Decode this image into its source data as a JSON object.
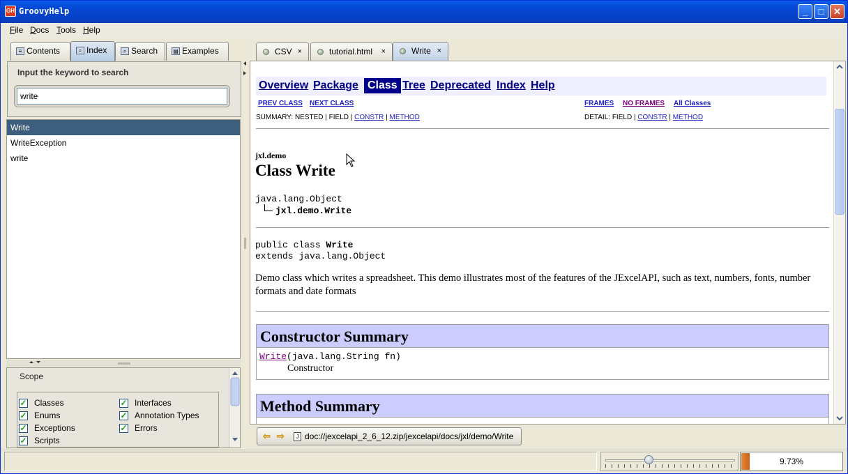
{
  "window": {
    "title": "GroovyHelp",
    "icon_label": "GH",
    "minimize": "_",
    "maximize": "□",
    "close": "✕"
  },
  "menubar": [
    {
      "key": "F",
      "rest": "ile"
    },
    {
      "key": "D",
      "rest": "ocs"
    },
    {
      "key": "T",
      "rest": "ools"
    },
    {
      "key": "H",
      "rest": "elp"
    }
  ],
  "left_tabs": [
    "Contents",
    "Index",
    "Search",
    "Examples"
  ],
  "left_tabs_selected": "Index",
  "index_panel": {
    "label": "Input the keyword to search",
    "search_value": "write"
  },
  "results": [
    "Write",
    "WriteException",
    "write"
  ],
  "selected_result": "Write",
  "scope": {
    "label": "Scope",
    "options": [
      {
        "label": "Classes",
        "checked": true
      },
      {
        "label": "Interfaces",
        "checked": true
      },
      {
        "label": "Enums",
        "checked": true
      },
      {
        "label": "Annotation Types",
        "checked": true
      },
      {
        "label": "Exceptions",
        "checked": true
      },
      {
        "label": "Errors",
        "checked": true
      },
      {
        "label": "Scripts",
        "checked": true
      }
    ]
  },
  "doc_tabs": [
    "CSV",
    "tutorial.html",
    "Write"
  ],
  "doc_tabs_selected": "Write",
  "tab_close_glyph": "×",
  "javadoc": {
    "nav": [
      "Overview",
      "Package",
      "Class",
      "Tree",
      "Deprecated",
      "Index",
      "Help"
    ],
    "nav_selected": "Class",
    "prev_class": "PREV CLASS",
    "next_class": "NEXT CLASS",
    "frames": "FRAMES",
    "no_frames": "NO FRAMES",
    "all_classes": "All Classes",
    "summary_prefix": "SUMMARY: NESTED | FIELD | ",
    "detail_prefix": "DETAIL: FIELD | ",
    "constr": "CONSTR",
    "method": "METHOD",
    "separator": " | ",
    "package": "jxl.demo",
    "class_title": "Class Write",
    "inherit_root": "java.lang.Object",
    "inherit_child": "jxl.demo.Write",
    "decl_line1_prefix": "public class ",
    "decl_line1_name": "Write",
    "decl_line2": "extends java.lang.Object",
    "description": "Demo class which writes a spreadsheet. This demo illustrates most of the features of the JExcelAPI, such as text, numbers, fonts, number formats and date formats",
    "constructor_summary_title": "Constructor Summary",
    "constructor_name": "Write",
    "constructor_params": "(java.lang.String fn)",
    "constructor_desc": "Constructor",
    "method_summary_title": "Method Summary"
  },
  "path_bar": {
    "back": "⇦",
    "forward": "⇨",
    "path": "doc://jexcelapi_2_6_12.zip/jexcelapi/docs/jxl/demo/Write"
  },
  "status": {
    "zoom_percent": 9.73,
    "zoom_label": "9.73%"
  }
}
